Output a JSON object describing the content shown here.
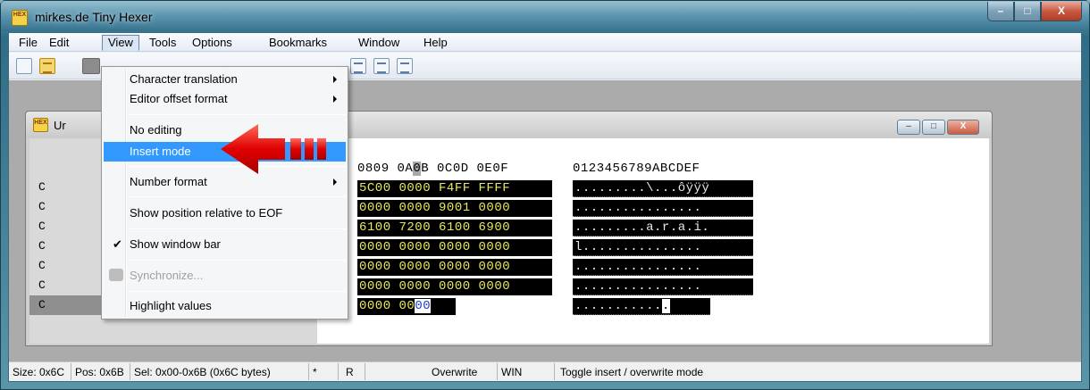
{
  "window": {
    "title": "mirkes.de Tiny Hexer",
    "icon_text": "HEX",
    "minimize": "–",
    "maximize": "□",
    "close": "X"
  },
  "menubar": {
    "items": [
      "File",
      "Edit",
      "View",
      "Tools",
      "Options",
      "Bookmarks",
      "Window",
      "Help"
    ]
  },
  "child": {
    "title": "Ur",
    "minimize": "–",
    "maximize": "□",
    "close": "X"
  },
  "hex_header": {
    "before": "0809 0A",
    "cursor": "0",
    "after": "B 0C0D 0E0F",
    "ascii": "0123456789ABCDEF"
  },
  "offsets": [
    "C",
    "C",
    "C",
    "C",
    "C",
    "C",
    "C"
  ],
  "hex_rows": [
    "5C00 0000 F4FF FFFF",
    "0000 0000 9001 0000",
    "6100 7200 6100 6900",
    "0000 0000 0000 0000",
    "0000 0000 0000 0000",
    "0000 0000 0000 0000"
  ],
  "hex_last": {
    "before": "0000 00",
    "cursor": "00"
  },
  "ascii_rows": [
    ".........\\...ôÿÿÿ",
    "................",
    ".........a.r.a.i.",
    "l...............",
    "................",
    "................"
  ],
  "ascii_last": {
    "before": "...........",
    "cursor": "."
  },
  "view_menu": {
    "items": [
      {
        "label": "Character translation",
        "submenu": true
      },
      {
        "label": "Editor offset format",
        "submenu": true
      },
      {
        "label": "No editing"
      },
      {
        "label": "Insert mode",
        "highlighted": true
      },
      {
        "label": "Number format",
        "submenu": true
      },
      {
        "label": "Show position relative to EOF"
      },
      {
        "label": "Show window bar",
        "checked": true
      },
      {
        "label": "Synchronize...",
        "disabled": true
      },
      {
        "label": "Highlight values"
      }
    ],
    "check_glyph": "✔"
  },
  "statusbar": {
    "size": "Size: 0x6C",
    "pos": "Pos: 0x6B",
    "sel": "Sel: 0x00-0x6B (0x6C bytes)",
    "modified": "*",
    "readonly": "R",
    "mode": "Overwrite",
    "charset": "WIN",
    "hint": "Toggle insert / overwrite mode"
  },
  "colors": {
    "highlight": "#3399ff",
    "hex_text": "#e8e85c",
    "arrow": "#e00000"
  }
}
